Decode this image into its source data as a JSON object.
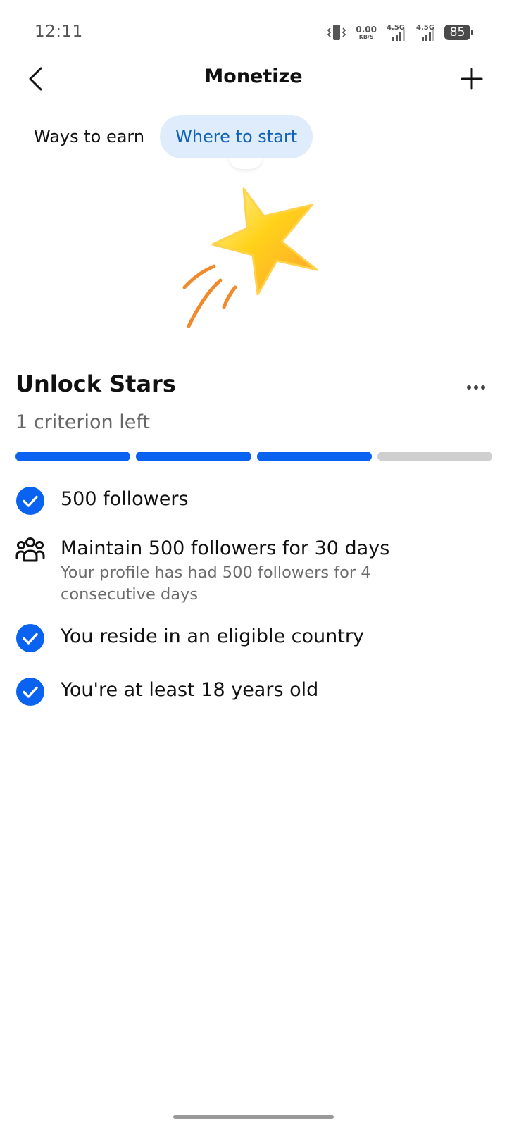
{
  "status_bar": {
    "time": "12:11",
    "net_speed_value": "0.00",
    "net_speed_unit": "KB/S",
    "sim1_label": "4.5G",
    "sim2_label": "4.5G",
    "battery": "85"
  },
  "header": {
    "title": "Monetize",
    "back_icon": "chevron-left-icon",
    "add_icon": "plus-icon"
  },
  "tabs": [
    {
      "label": "Ways to earn",
      "active": false
    },
    {
      "label": "Where to start",
      "active": true
    }
  ],
  "illustration": {
    "icon": "shooting-star-icon"
  },
  "unlock": {
    "title": "Unlock Stars",
    "subtitle": "1 criterion left",
    "progress": {
      "completed": 3,
      "total": 4
    }
  },
  "criteria": [
    {
      "label": "500 followers",
      "status": "done",
      "icon": "check-circle-icon"
    },
    {
      "label": "Maintain 500 followers for 30 days",
      "detail": "Your profile has had 500 followers for 4 consecutive days",
      "status": "pending",
      "icon": "followers-group-icon"
    },
    {
      "label": "You reside in an eligible country",
      "status": "done",
      "icon": "check-circle-icon"
    },
    {
      "label": "You're at least 18 years old",
      "status": "done",
      "icon": "check-circle-icon"
    }
  ],
  "colors": {
    "accent": "#0a63f0",
    "tab_active_bg": "#deecfb",
    "tab_active_text": "#1163b8",
    "progress_remaining": "#cfcfcf"
  }
}
